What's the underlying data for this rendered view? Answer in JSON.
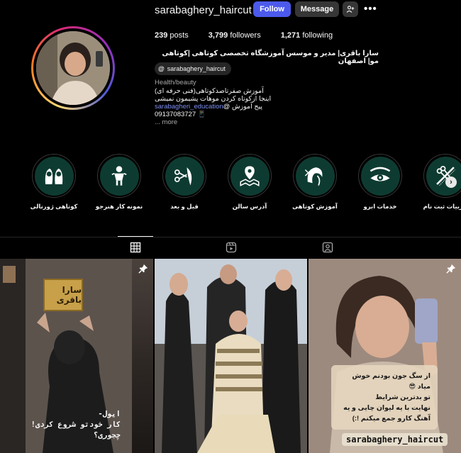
{
  "profile": {
    "username": "sarabaghery_haircut",
    "follow_label": "Follow",
    "message_label": "Message",
    "more_icon": "more-horizontal-icon",
    "suggest_icon": "add-person-icon"
  },
  "stats": {
    "posts_count": "239",
    "posts_label": "posts",
    "followers_count": "3,799",
    "followers_label": "followers",
    "following_count": "1,271",
    "following_label": "following"
  },
  "bio": {
    "name": "سارا باقری| مدیر و موسس آموزشگاه تخصصی کوتاهی |کوتاهی مو| اصفهان",
    "threads_handle": "sarabaghery_haircut",
    "category": "Health/beauty",
    "line1": "آموزش صفرتاصدکوتاهی(فنی حرفه ای)",
    "line2": "اینجا ازکوتاه کردن موهات پشیمون نمیشی",
    "line3_prefix": "پیج آموزش @",
    "line3_link": "sarabagheri_education",
    "phone": "09137083727 📱",
    "more": "... more"
  },
  "highlights": [
    {
      "label": "جزییات ثبت نام",
      "icon": "scissors-comb-icon"
    },
    {
      "label": "خدمات ابرو",
      "icon": "eye-brow-icon"
    },
    {
      "label": "آموزش کوتاهی",
      "icon": "hair-model-icon"
    },
    {
      "label": "آدرس سالن",
      "icon": "location-map-icon"
    },
    {
      "label": "قبل و بعد",
      "icon": "scissors-hair-icon"
    },
    {
      "label": "نمونه کار هنرجو",
      "icon": "student-icon"
    },
    {
      "label": "کوتاهی ژورنالی",
      "icon": "women-hair-icon"
    }
  ],
  "tabs": [
    {
      "name": "posts",
      "icon": "grid-icon",
      "active": true
    },
    {
      "name": "reels",
      "icon": "reels-icon",
      "active": false
    },
    {
      "name": "tagged",
      "icon": "tagged-user-icon",
      "active": false
    }
  ],
  "posts": {
    "post1": {
      "plaque": "سارا باقری",
      "caption_l1": "ایول-",
      "caption_l2": "کار خودتو شروع کردی!",
      "caption_l3": "چجوری؟"
    },
    "post3": {
      "line1": "از سگ جون بودنم خوش میاد 😎",
      "line2": "تو بدترین شرایط",
      "line3": "نهایت با یه لیوان چایی و یه",
      "line4": "آهنگ کارو جمع میکنم !:)",
      "tag": "sarabaghery_haircut"
    }
  },
  "colors": {
    "follow_button": "#4c5aec",
    "highlight_bg": "#0e3b31",
    "link": "#7d8ef0"
  }
}
